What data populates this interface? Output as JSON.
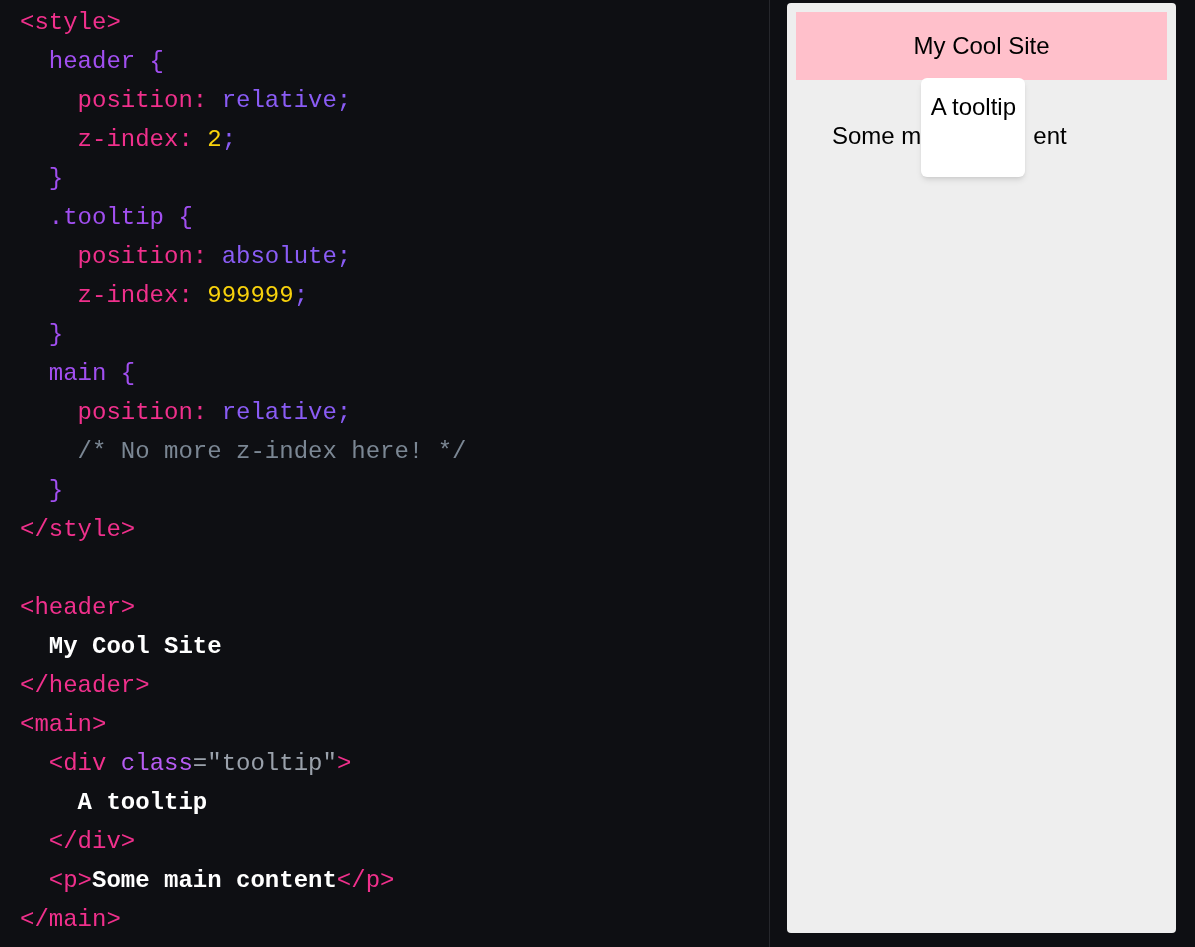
{
  "code_blocks": [
    {
      "lines": [
        [
          {
            "kind": "tag",
            "text": "<style>"
          }
        ],
        [
          {
            "kind": "selector",
            "text": "  header {"
          }
        ],
        [
          {
            "kind": "prop",
            "text": "    position: "
          },
          {
            "kind": "value",
            "text": "relative;"
          }
        ],
        [
          {
            "kind": "prop",
            "text": "    z-index: "
          },
          {
            "kind": "number",
            "text": "2"
          },
          {
            "kind": "value",
            "text": ";"
          }
        ],
        [
          {
            "kind": "selector",
            "text": "  }"
          }
        ],
        [
          {
            "kind": "selector",
            "text": "  .tooltip {"
          }
        ],
        [
          {
            "kind": "prop",
            "text": "    position: "
          },
          {
            "kind": "value",
            "text": "absolute;"
          }
        ],
        [
          {
            "kind": "prop",
            "text": "    z-index: "
          },
          {
            "kind": "number",
            "text": "999999"
          },
          {
            "kind": "value",
            "text": ";"
          }
        ],
        [
          {
            "kind": "selector",
            "text": "  }"
          }
        ],
        [
          {
            "kind": "selector",
            "text": "  main {"
          }
        ],
        [
          {
            "kind": "prop",
            "text": "    position: "
          },
          {
            "kind": "value",
            "text": "relative;"
          }
        ],
        [
          {
            "kind": "comment",
            "text": "    /* No more z-index here! */"
          }
        ],
        [
          {
            "kind": "selector",
            "text": "  }"
          }
        ],
        [
          {
            "kind": "tag",
            "text": "</style>"
          }
        ]
      ]
    },
    {
      "lines": [
        [
          {
            "kind": "tag",
            "text": "<header>"
          }
        ],
        [
          {
            "kind": "text",
            "text": "  My Cool Site"
          }
        ],
        [
          {
            "kind": "tag",
            "text": "</header>"
          }
        ],
        [
          {
            "kind": "tag",
            "text": "<main>"
          }
        ],
        [
          {
            "kind": "tag",
            "text": "  <div "
          },
          {
            "kind": "attr",
            "text": "class"
          },
          {
            "kind": "string",
            "text": "=\"tooltip\""
          },
          {
            "kind": "tag",
            "text": ">"
          }
        ],
        [
          {
            "kind": "text",
            "text": "    A tooltip"
          }
        ],
        [
          {
            "kind": "tag",
            "text": "  </div>"
          }
        ],
        [
          {
            "kind": "tag",
            "text": "  <p>"
          },
          {
            "kind": "text",
            "text": "Some main content"
          },
          {
            "kind": "tag",
            "text": "</p>"
          }
        ],
        [
          {
            "kind": "tag",
            "text": "</main>"
          }
        ]
      ]
    }
  ],
  "preview": {
    "header_title": "My Cool Site",
    "main_fragments": [
      "Some m",
      "ent"
    ],
    "tooltip_text": "A tooltip"
  }
}
